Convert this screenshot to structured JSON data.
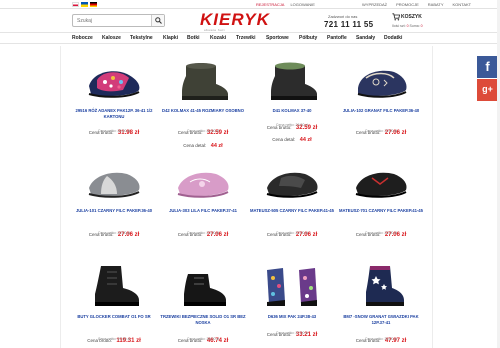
{
  "header": {
    "languages": [
      "Polski",
      "Українська",
      "Deutsch"
    ],
    "top_links_left": [
      "Rejestracja",
      "Logowanie"
    ],
    "top_links_right": [
      "Wyprzedaż",
      "Promocje",
      "Rabaty",
      "Kontakt"
    ],
    "search_placeholder": "Szukaj",
    "logo_text": "KIERYK",
    "logo_sub": "obuwie hurt",
    "phone_label": "Zadzwoń do nas",
    "phone_number": "721 11 11 55",
    "cart_label": "KOSZYK",
    "cart_items_label": "Ilość szt:",
    "cart_items": "0",
    "cart_sum_label": "Suma:",
    "cart_sum": "0",
    "icons": [
      "search-icon",
      "cart-icon",
      "facebook-icon",
      "google-plus-icon"
    ]
  },
  "nav": [
    "Robocze",
    "Kalosze",
    "Tekstylne",
    "Klapki",
    "Botki",
    "Kozaki",
    "Trzewiki",
    "Sportowe",
    "Półbuty",
    "Pantofle",
    "Sandały",
    "Dodatki"
  ],
  "labels": {
    "price_gross": "Cena brutto:",
    "price_detal": "Cena detal:"
  },
  "products": [
    {
      "name": "29516 RÓŻ ADANEX PAK12P. 36-41 1/2 KARTONU",
      "price": "31.98 zł",
      "net": "Cena netto: 26,00 zł",
      "detal": ""
    },
    {
      "name": "D42 KOLMAX 41-45 ROZMIARY OSOBNO",
      "price": "32.59 zł",
      "net": "Cena netto: 26,50 zł",
      "detal": "44 zł"
    },
    {
      "name": "D41 KOLMAX 37-40",
      "price": "32.59 zł",
      "net": "Cena netto: 26,50 zł",
      "detal": "44 zł"
    },
    {
      "name": "JULIA-102 GRANAT FILC PAKEP.36-40",
      "price": "27.06 zł",
      "net": "Cena netto: 22,00 zł",
      "detal": ""
    },
    {
      "name": "JULIA-101 CZARNY FILC PAKEP.36-40",
      "price": "27.06 zł",
      "net": "Cena netto: 22,00 zł",
      "detal": ""
    },
    {
      "name": "JULIA-303 LILA FILC PAKEP.37-41",
      "price": "27.06 zł",
      "net": "Cena netto: 22,00 zł",
      "detal": ""
    },
    {
      "name": "MATEUSZ-505 CZARNY FILC PAKEP.41-45",
      "price": "27.06 zł",
      "net": "Cena netto: 22,00 zł",
      "detal": ""
    },
    {
      "name": "MATEUSZ-701 CZARNY FILC PAKEP.41-45",
      "price": "27.06 zł",
      "net": "Cena netto: 22,00 zł",
      "detal": ""
    },
    {
      "name": "BUTY GLOCKER COMBAT O1 FO SR",
      "price": "119.31 zł",
      "net": "Cena netto: 97,00 zł",
      "detal": ""
    },
    {
      "name": "TRZEWIKI BEZPIECZNE SOLID O1 SR BEZ NOSKA",
      "price": "46.74 zł",
      "net": "Cena netto: 38,00 zł",
      "detal": ""
    },
    {
      "name": "D636 MIX PAK 24P.38-43",
      "price": "33.21 zł",
      "net": "Cena netto: 27,00 zł",
      "detal": ""
    },
    {
      "name": "BM7 -SNOW GRANAT GWIAZDKI PAK 12P.37-41",
      "price": "47.97 zł",
      "net": "Cena netto: 39,00 zł",
      "detal": ""
    }
  ],
  "colors": {
    "accent": "#d01212",
    "price": "#d9181d",
    "product_link": "#1a3fa0",
    "facebook": "#3b5998",
    "google_plus": "#dd4b39"
  }
}
